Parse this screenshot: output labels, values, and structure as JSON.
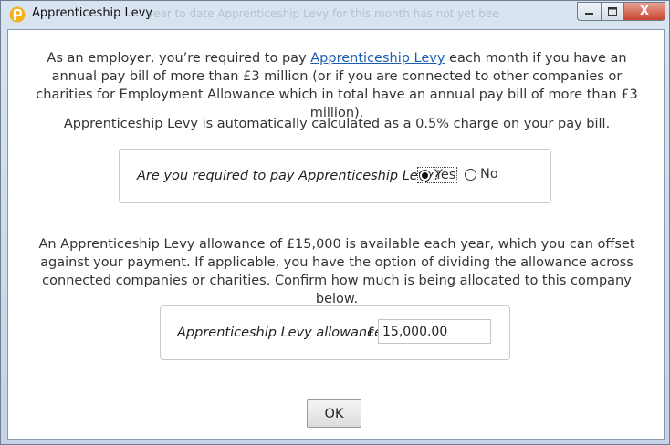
{
  "window": {
    "title": "Apprenticeship Levy",
    "background_text": "year to date Apprenticeship Levy for this month has not yet bee",
    "controls": {
      "close_label": "X"
    }
  },
  "intro": {
    "prefix": "As an employer, you’re required to pay ",
    "link_text": "Apprenticeship Levy",
    "suffix": " each month if you have an annual pay bill of more than £3 million (or if you are connected to other companies or charities for Employment Allowance which in total have an annual pay bill of more than £3 million)."
  },
  "calculation_text": "Apprenticeship Levy is automatically calculated as a 0.5% charge on your pay bill.",
  "question": {
    "label": "Are you required to pay Apprenticeship Levy?",
    "options": [
      {
        "label": "Yes",
        "selected": true
      },
      {
        "label": "No",
        "selected": false
      }
    ]
  },
  "allowance_text": "An Apprenticeship Levy allowance of £15,000 is available each year, which you can offset against your payment. If applicable, you have the option of dividing the allowance across connected companies or charities. Confirm how much is being allocated to this company below.",
  "allowance": {
    "label": "Apprenticeship Levy allowance",
    "currency": "£",
    "value": "15,000.00"
  },
  "ok_label": "OK",
  "colors": {
    "link": "#1a5fb4",
    "close_button": "#c7452f",
    "app_icon": "#f3b21b"
  }
}
